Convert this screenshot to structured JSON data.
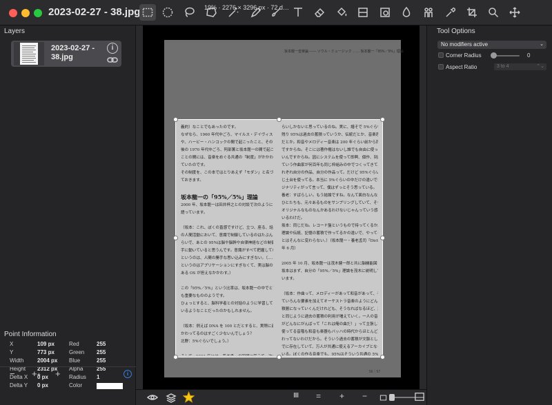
{
  "window": {
    "title": "2023-02-27 - 38.jpg"
  },
  "toolbar": {
    "tools": [
      "rectangle-select-icon",
      "ellipse-select-icon",
      "lasso-select-icon",
      "polygon-select-icon",
      "magic-wand-icon",
      "pen-icon",
      "brush-icon",
      "text-icon",
      "eraser-icon",
      "fill-bucket-icon",
      "gradient-icon",
      "stamp-icon",
      "blur-drop-icon",
      "people-icon",
      "eyedropper-icon",
      "crop-icon",
      "zoom-icon",
      "move-icon"
    ]
  },
  "layers_panel": {
    "title": "Layers",
    "layer": {
      "name": "2023-02-27 - 38.jpg"
    }
  },
  "point_info": {
    "title": "Point Information",
    "rows": [
      {
        "label": "X",
        "value": "109 px",
        "label2": "Red",
        "value2": "255"
      },
      {
        "label": "Y",
        "value": "773 px",
        "label2": "Green",
        "value2": "255"
      },
      {
        "label": "Width",
        "value": "2004 px",
        "label2": "Blue",
        "value2": "255"
      },
      {
        "label": "Height",
        "value": "2312 px",
        "label2": "Alpha",
        "value2": "255"
      },
      {
        "label": "Delta X",
        "value": "0 px",
        "label2": "Radius",
        "value2": "1"
      },
      {
        "label": "Delta Y",
        "value": "0 px",
        "label2": "Color",
        "value2": ""
      }
    ],
    "color_swatch": "#ffffff"
  },
  "left_bottom": {
    "remove": "−",
    "add_group": "+",
    "add": "+"
  },
  "status_bar": {
    "info": "19% · 2276 × 3296 px · 72 d…",
    "equals": "=",
    "plus": "+",
    "minus": "−"
  },
  "tool_options": {
    "title": "Tool Options",
    "modifiers": "No modifiers active",
    "corner_radius_label": "Corner Radius",
    "corner_radius_value": "0",
    "aspect_ratio_label": "Aspect Ratio",
    "aspect_ratio_value": "3 to 4"
  },
  "document": {
    "header": "坂本龍一音楽論 —— ソウル・ミュージック …… 坂本龍一「95%／5%」理論",
    "footer": "56｜57",
    "heading": "坂本龍一の「95%／5%」理論",
    "left_column": [
      "義的）なことでもあったのです。",
      "なぜなら、1960 年代中ごろ、マイルス・デイヴィス",
      "や、ハービー・ハンコックの間で起こったこと、その 10 年",
      "後の 1970 年代中ごろ、阿部薫と坂本龍一の間で起こった",
      "ことの間には、音楽をめぐる共通の「制度」がかかわっ",
      "ていたのです。",
      "その制度を、この本ではとりあえず「モダン」と名づけ",
      "ておきます。",
      "",
      "2000 年、坂本龍一は田井梓之との対談で次のように",
      "語っています。",
      "",
      "（坂本：これ、ぼくの直感ですけど、立つ、座る、話すなど",
      "の人間活動において、意識で制御しているのはたぶん 5%ぐ",
      "らいで、あとの 95%は脳や脳幹や自律神経などの制御で勝",
      "手に動いていると思うんです。意識がすべて把握している",
      "というのは、人間の勝手な思い込みにすぎない。（……）意識",
      "というのはアプリケーションにすぎなくて、実は脳の中に",
      "ある OS が担えなかかわす。）",
      "",
      "この「95%／5%」という比率は、坂本龍一の中でとて",
      "も重要なもののようです。",
      "ひょっとすると、脳科学者との対話のように学習して",
      "いるようなことだったのかもしれません。",
      "",
      "（坂本：例えば DNA を 100 とだとすると、実際に遺伝子にか",
      "かわってるのはすごく少ないんでしょう？",
      "北野：5%ぐらいでしょう。）",
      "",
      "そして、2001 年には、養老孟一の回顧に答えて、次の",
      "ように語っています。",
      "",
      "（坂本：音楽をつくってもその中にオリジナリティは 5%で"
    ],
    "right_column": [
      "らいしかないと思っているのね。実に、譜そで 5%ぐらいで。",
      "残り 95%は過去の蓄積っていうか、伝統だとか、音楽理論",
      "だとか。和音やメロディー音楽は 200 年ぐらい前から同じもの",
      "ですからね。そこには著作権はないし誰でも自由に使ってい",
      "いんですからね。因にシステムを使って即興、個作、到底入っ",
      "ていう作曲家が何百年も同じ枠組みの中でつくってきて、そ",
      "れぞれ自分の作品、自分の作品って。だけど 95%ぐらいは同",
      "じ土台を使ってる。本当に 5%ぐらいの中だけの違いでオリ",
      "ジナリティがって言って、僕はずっとそう思っている。",
      "養老：すばらしい。もう結論ですね。なんて面白なんなんだ。",
      "ひとたちも、元々あるものをサンプリングしていて、そもそも",
      "オリジナルなものなんかあるわけないじゃんっていう感じで",
      "いるわけだ。",
      "坂本：同じだね。レコード盤というもので持ってくるか。",
      "理論や伝統、記憶の蓄積で作ってるかの違いで、やってるこ",
      "とはそんなに変わらない。）（坂本龍一・養老孟司『Dictionary 脳』2007",
      "年 6 月）",
      "",
      "2005 年 10 月、坂本龍一は茂木健一郎と共に脳機能図",
      "坂本はまず、自分の「95%／5%」理論を茂木に説明して",
      "います。",
      "",
      "（坂本：作曲って、メロディーがあって和音があって、そし",
      "ていろんな要素を加えてオーケストラ音楽のようにどんどん",
      "積層になっていくんだけれども、そうなればなるほど、過去",
      "と同じように過去の蓄積の利用が増えていく。一人の音楽家",
      "がどんなにがんばって「これは俺の曲だ！」って主張しても、",
      "使ってる音階も和音も楽器もバッハの時代からほとんど変",
      "わってないわけだから。そういう過去の蓄積が文脈としてす",
      "でに存在していて、万人が共通に使えるアーカイブとなって",
      "いる。ぼくの作る音楽でも、95%はそういう共通の 5%が",
      "いいとこですよね。バッハやモーツァルトといった歴史上の",
      "天才であってもそれは変わらないでしょう。それもだけ、いま",
      "ま、茂木さんの言った言語もサンプリングで成り立っている。"
    ]
  }
}
